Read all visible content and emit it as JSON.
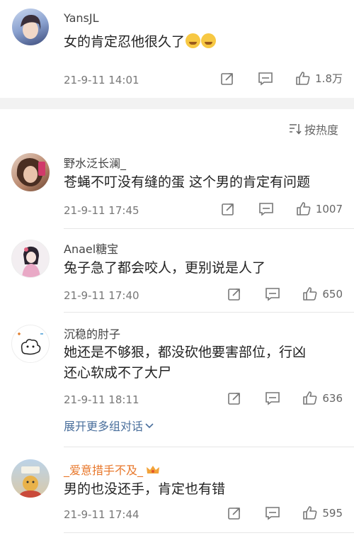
{
  "comments": [
    {
      "username": "YansJL",
      "text": "女的肯定忍他很久了",
      "time": "21-9-11 14:01",
      "likes": "1.8万"
    },
    {
      "username": "野水泛长澜_",
      "text": "苍蝇不叮没有缝的蛋 这个男的肯定有问题",
      "time": "21-9-11 17:45",
      "likes": "1007"
    },
    {
      "username": "Anael糖宝",
      "text": "兔子急了都会咬人，更别说是人了",
      "time": "21-9-11 17:40",
      "likes": "650"
    },
    {
      "username": "沉稳的肘子",
      "text_line1": "她还是不够狠，都没砍他要害部位，行凶",
      "text_line2": "还心软成不了大尸",
      "time": "21-9-11 18:11",
      "likes": "636"
    },
    {
      "username": "_爱意措手不及_",
      "text": "男的也没还手，肯定也有错",
      "time": "21-9-11 17:44",
      "likes": "595"
    }
  ],
  "sort_label": "按热度",
  "expand_label": "展开更多组对话",
  "icons": {
    "sort": "sort-icon",
    "share": "share-icon",
    "reply": "comment-icon",
    "like": "thumbs-up-icon",
    "expand": "chevron-down-icon",
    "badge": "crown-badge-icon"
  },
  "colors": {
    "link": "#4a6f9c",
    "vip_name": "#e8782c",
    "divider_gap": "#f2f2f2"
  }
}
